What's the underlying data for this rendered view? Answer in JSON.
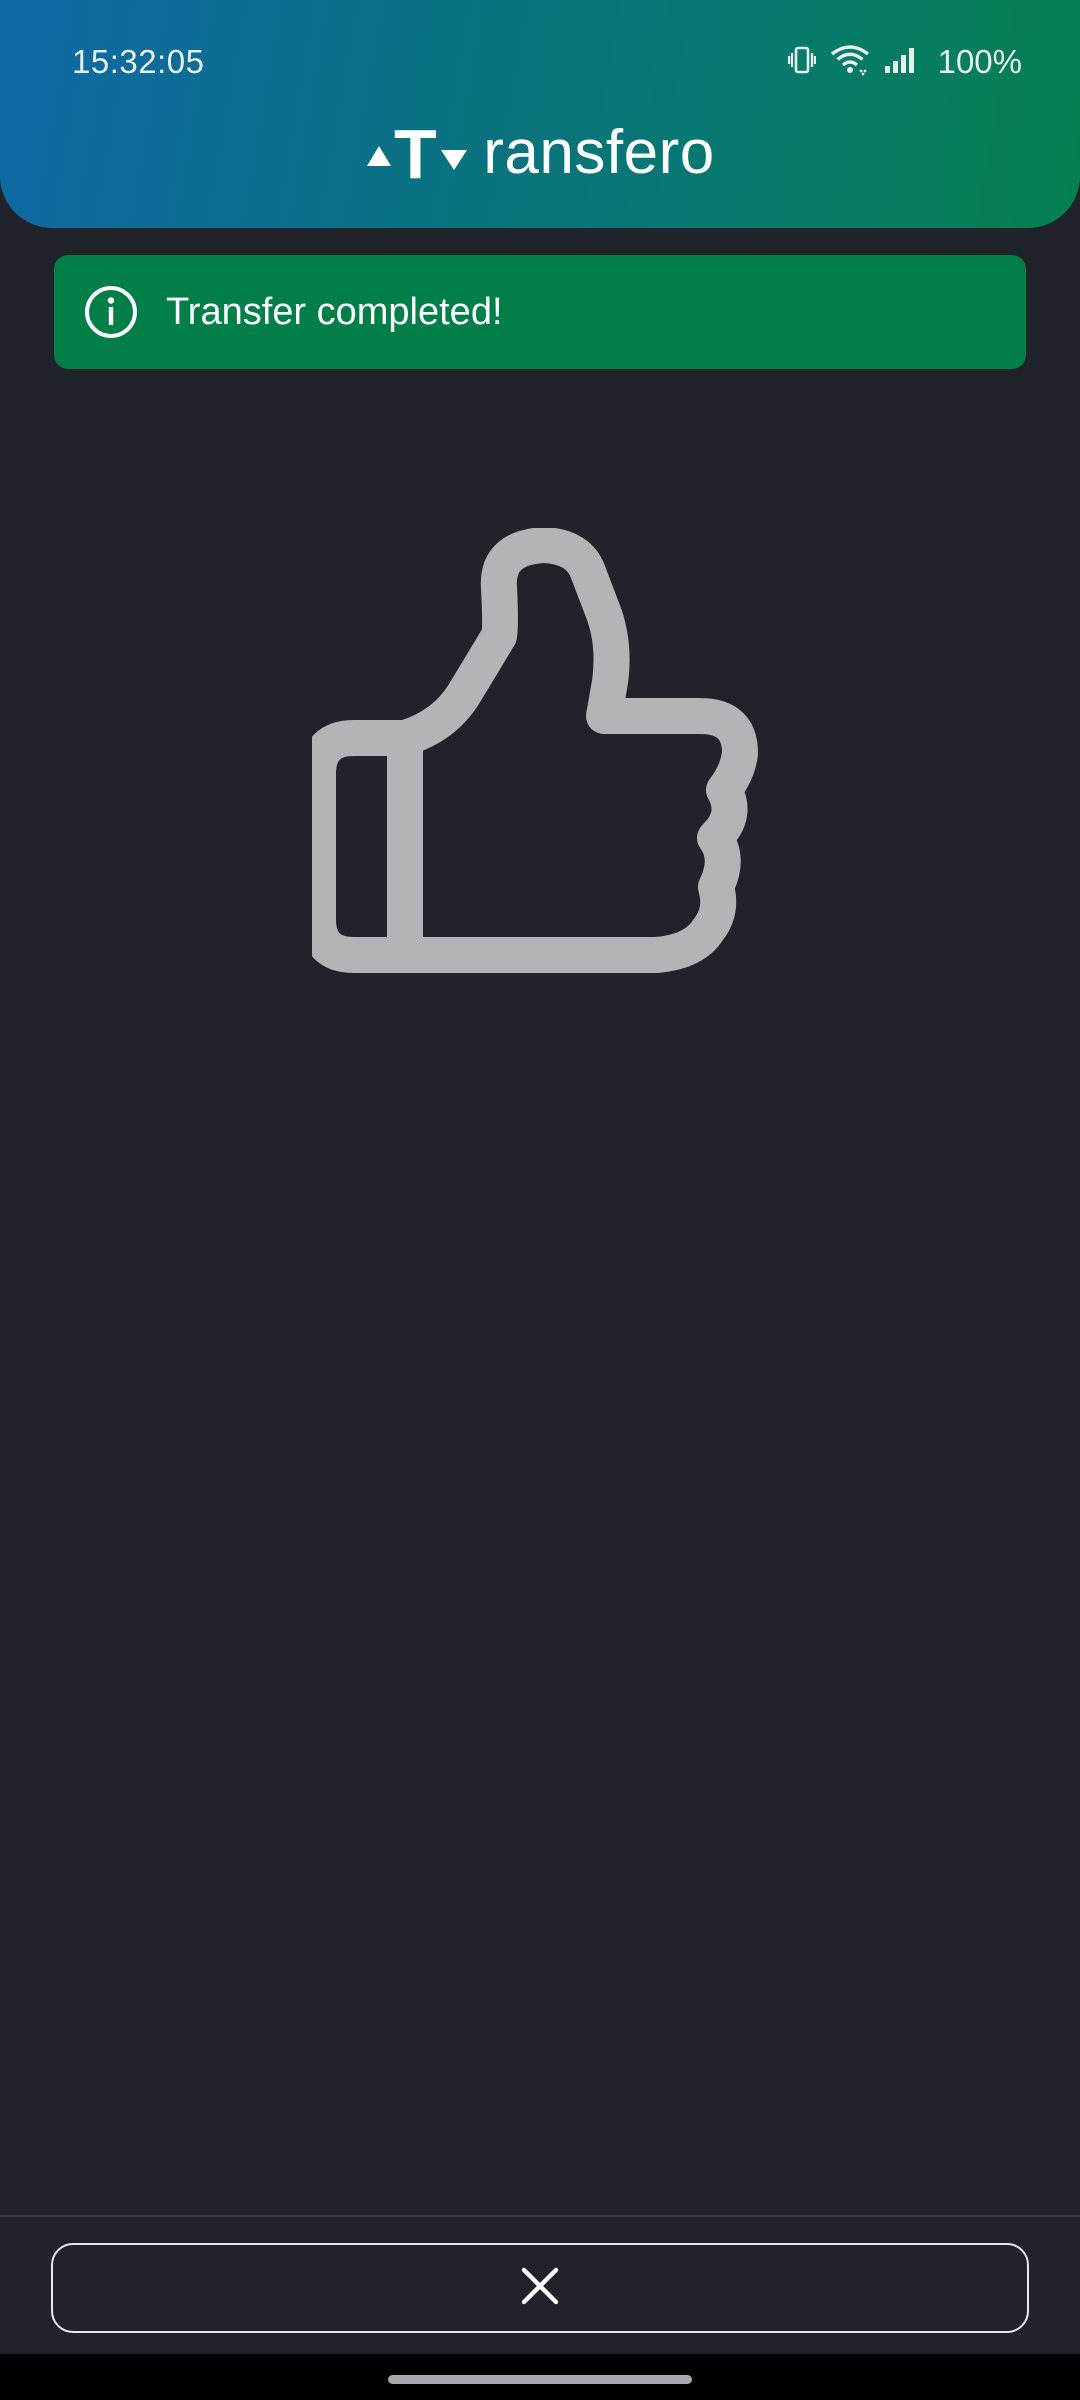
{
  "status_bar": {
    "time": "15:32:05",
    "battery": "100%",
    "icons": [
      "vibrate-icon",
      "wifi-icon",
      "signal-icon"
    ]
  },
  "header": {
    "logo_text": "ransfero",
    "logo_mark": "T",
    "gradient": [
      "#0e69a6",
      "#04804f"
    ]
  },
  "banner": {
    "icon": "info-icon",
    "message": "Transfer completed!",
    "color": "#027e48"
  },
  "content": {
    "illustration": "thumbs-up-icon",
    "illustration_color": "#b3b4b7"
  },
  "footer": {
    "close_icon": "close-icon"
  },
  "theme": {
    "background": "#21232a",
    "text": "#ffffff"
  }
}
